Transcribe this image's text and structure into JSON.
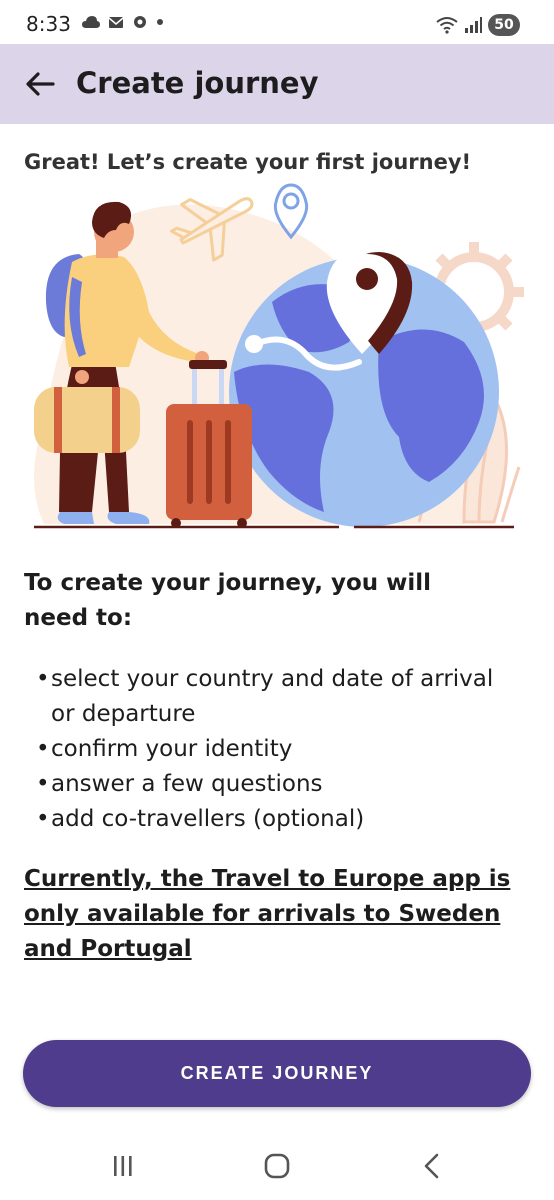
{
  "status_bar": {
    "time": "8:33",
    "battery": "50",
    "left_icons": [
      "cloud-icon",
      "mail-icon",
      "settings-icon",
      "dot-icon"
    ],
    "right_icons": [
      "wifi-icon",
      "signal-icon",
      "battery-icon"
    ]
  },
  "app_bar": {
    "title": "Create journey",
    "back_icon": "arrow-left-icon",
    "background": "#dcd5ea"
  },
  "intro": "Great! Let’s create your first journey!",
  "requirements": {
    "heading": "To create your journey, you will need to:",
    "items": [
      "select your country and date of arrival or departure",
      "confirm your identity",
      "answer a few questions",
      "add co-travellers (optional)"
    ]
  },
  "notice": "Currently, the Travel to Europe app is only available for arrivals to Sweden and Portugal",
  "cta": {
    "label": "CREATE JOURNEY",
    "color": "#4f3c8c"
  },
  "nav": {
    "recents_icon": "recents-icon",
    "home_icon": "home-icon",
    "back_icon": "back-chevron-icon"
  }
}
